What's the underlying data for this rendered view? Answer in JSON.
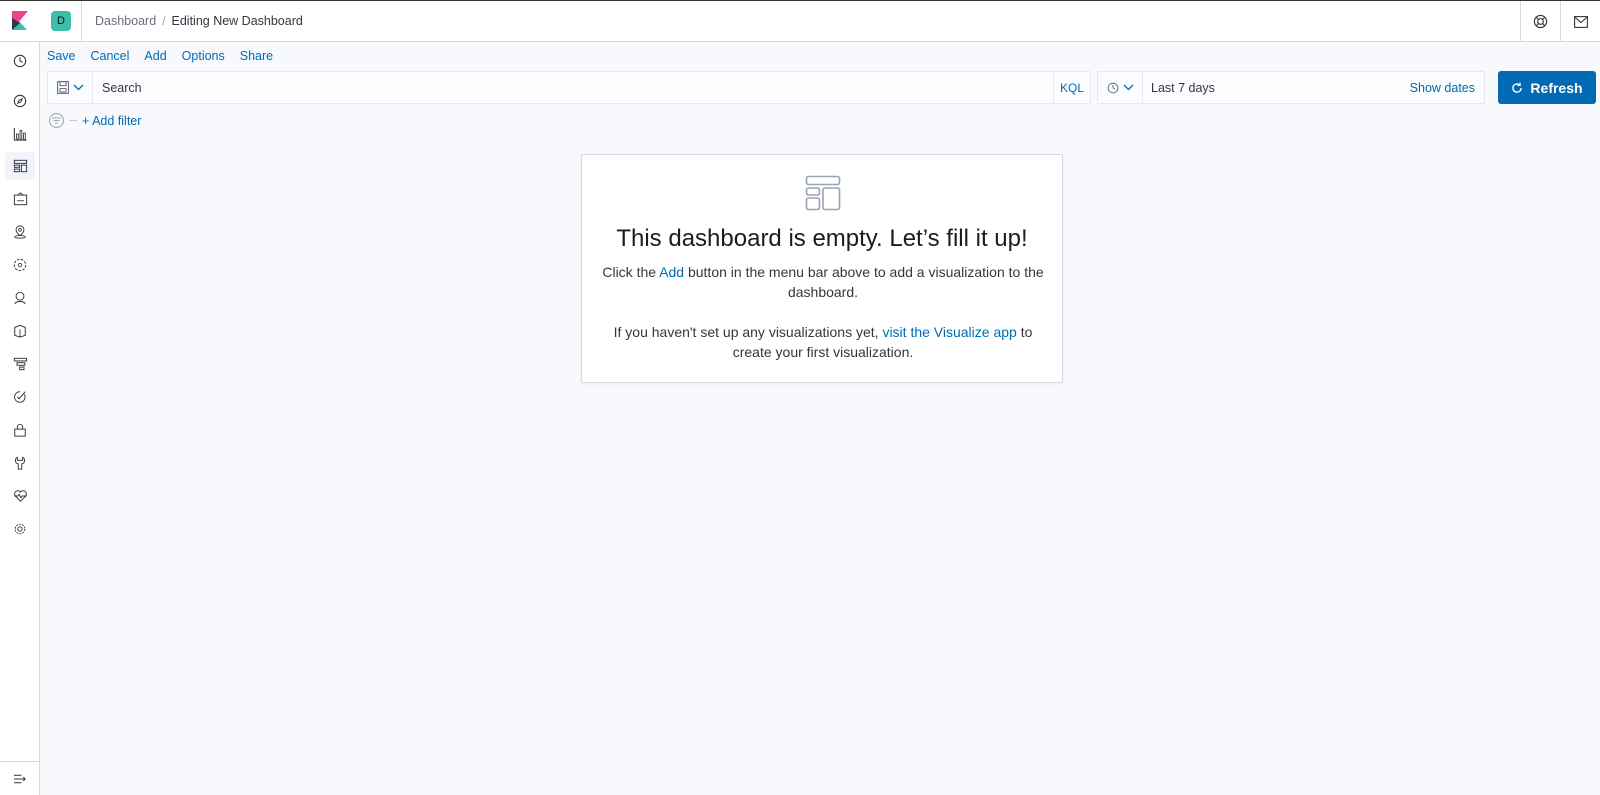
{
  "header": {
    "space_initial": "D",
    "breadcrumbs": [
      "Dashboard",
      "Editing New Dashboard"
    ],
    "right_icons": [
      "help-icon",
      "newsfeed-icon"
    ]
  },
  "sidenav": {
    "items": [
      {
        "name": "recently-viewed",
        "icon": "clock-icon"
      },
      {
        "name": "discover",
        "icon": "compass-icon"
      },
      {
        "name": "visualize",
        "icon": "visualize-icon"
      },
      {
        "name": "dashboard",
        "icon": "dashboard-icon",
        "active": true
      },
      {
        "name": "canvas",
        "icon": "canvas-icon"
      },
      {
        "name": "maps",
        "icon": "maps-icon"
      },
      {
        "name": "machine-learning",
        "icon": "ml-icon"
      },
      {
        "name": "infrastructure",
        "icon": "infra-icon"
      },
      {
        "name": "logs",
        "icon": "logs-icon"
      },
      {
        "name": "apm",
        "icon": "apm-icon"
      },
      {
        "name": "uptime",
        "icon": "uptime-icon"
      },
      {
        "name": "siem",
        "icon": "siem-icon"
      },
      {
        "name": "dev-tools",
        "icon": "devtools-icon"
      },
      {
        "name": "monitoring",
        "icon": "monitoring-icon"
      },
      {
        "name": "management",
        "icon": "gear-icon"
      }
    ],
    "collapse_icon": "collapse-icon"
  },
  "top_menu": {
    "save": "Save",
    "cancel": "Cancel",
    "add": "Add",
    "options": "Options",
    "share": "Share"
  },
  "query_bar": {
    "search_placeholder": "Search",
    "search_value": "",
    "language": "KQL"
  },
  "date_picker": {
    "range": "Last 7 days",
    "show_dates": "Show dates"
  },
  "refresh": {
    "label": "Refresh"
  },
  "filter_bar": {
    "add_filter": "+ Add filter"
  },
  "empty_state": {
    "title": "This dashboard is empty. Let’s fill it up!",
    "p1_before": "Click the ",
    "p1_link": "Add",
    "p1_after": " button in the menu bar above to add a visualization to the dashboard.",
    "p2_before": "If you haven't set up any visualizations yet, ",
    "p2_link": "visit the Visualize app",
    "p2_after": " to create your first visualization."
  },
  "colors": {
    "accent": "#006bb4",
    "space_avatar": "#3bbfa9",
    "background": "#f7f9fc"
  }
}
